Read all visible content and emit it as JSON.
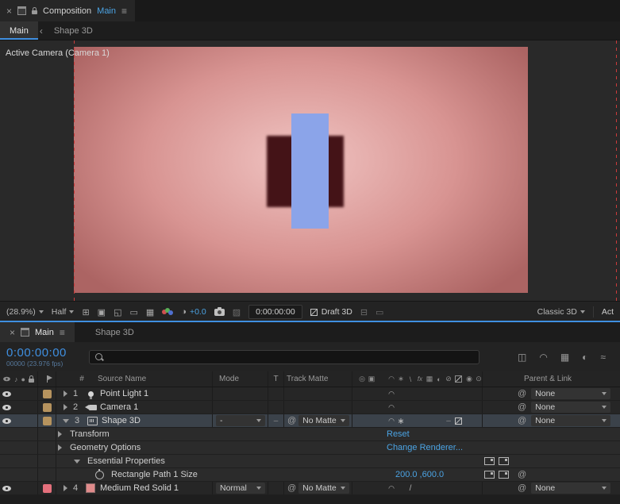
{
  "colors": {
    "accent": "#3f8fe0",
    "link_blue": "#4ba3e3",
    "comp_center": "#f0c4c2",
    "comp_mid": "#d89492",
    "comp_edge": "#ac6463",
    "shadow_rect": "#441317",
    "blue_rect": "#8ba4e9",
    "label_tan": "#b6935e",
    "label_red": "#e4707c",
    "solid_red": "#e08b8b",
    "guide_red": "#cc3b3b"
  },
  "comp_panel": {
    "tab": {
      "title": "Composition",
      "comp_name": "Main"
    },
    "viewer_tabs": [
      {
        "label": "Main"
      },
      {
        "label": "Shape 3D"
      }
    ],
    "viewer_label": "Active Camera (Camera 1)",
    "toolbar": {
      "zoom": "(28.9%)",
      "resolution": "Half",
      "exposure": "+0.0",
      "timecode": "0:00:00:00",
      "draft_3d": "Draft 3D",
      "renderer": "Classic 3D",
      "view": "Act"
    }
  },
  "timeline": {
    "tabs": [
      {
        "label": "Main"
      },
      {
        "label": "Shape 3D"
      }
    ],
    "timecode": "0:00:00:00",
    "frame_info": "00000 (23.976 fps)",
    "columns": {
      "number": "#",
      "source": "Source Name",
      "mode": "Mode",
      "t": "T",
      "matte": "Track Matte",
      "parent": "Parent & Link"
    },
    "layers": [
      {
        "num": "1",
        "name": "Point Light 1",
        "parent": "None"
      },
      {
        "num": "2",
        "name": "Camera 1",
        "parent": "None"
      },
      {
        "num": "3",
        "name": "Shape 3D",
        "mode": "-",
        "matte": "No Matte",
        "parent": "None"
      },
      {
        "num": "4",
        "name": "Medium Red Solid 1",
        "mode": "Normal",
        "matte": "No Matte",
        "parent": "None"
      }
    ],
    "properties": [
      {
        "name": "Transform",
        "value": "Reset"
      },
      {
        "name": "Geometry Options",
        "value": "Change Renderer..."
      },
      {
        "name": "Essential Properties",
        "value": ""
      },
      {
        "name": "Rectangle Path 1 Size",
        "x": "200.0",
        "sep": ",",
        "y": "600.0"
      }
    ]
  }
}
